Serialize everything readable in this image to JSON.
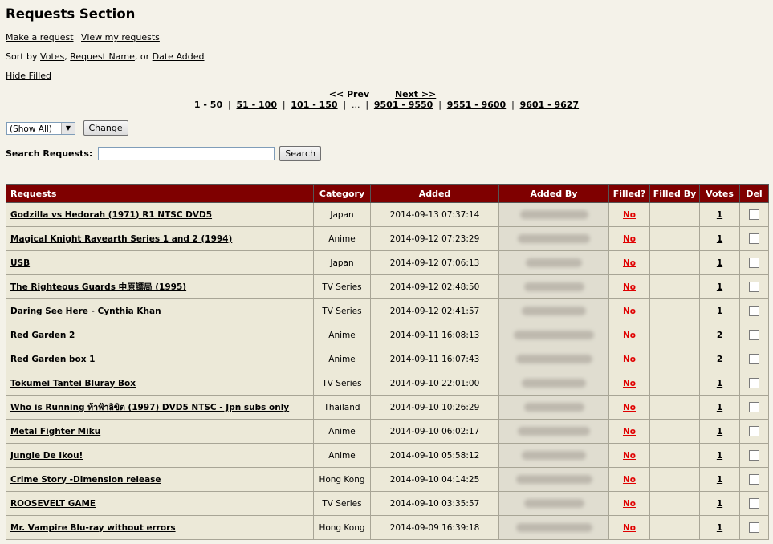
{
  "page_title": "Requests Section",
  "links": {
    "make_request": "Make a request",
    "view_my_requests": "View my requests",
    "hide_filled": "Hide Filled"
  },
  "sort": {
    "prefix": "Sort by",
    "votes": "Votes",
    "comma1": ",",
    "request_name": "Request Name",
    "or": ", or",
    "date_added": "Date Added"
  },
  "pager": {
    "prev": "<< Prev",
    "next": "Next >>",
    "current": "1 - 50",
    "pages": [
      "51 - 100",
      "101 - 150"
    ],
    "ellipsis": "...",
    "last_pages": [
      "9501 - 9550",
      "9551 - 9600",
      "9601 - 9627"
    ],
    "separator": "|"
  },
  "filter": {
    "selected": "(Show All)",
    "change_button": "Change"
  },
  "search": {
    "label": "Search Requests:",
    "value": "",
    "button": "Search"
  },
  "table": {
    "headers": [
      "Requests",
      "Category",
      "Added",
      "Added By",
      "Filled?",
      "Filled By",
      "Votes",
      "Del"
    ],
    "rows": [
      {
        "name": "Godzilla vs Hedorah (1971) R1 NTSC DVD5",
        "category": "Japan",
        "added": "2014-09-13 07:37:14",
        "filled": "No",
        "votes": "1"
      },
      {
        "name": "Magical Knight Rayearth Series 1 and 2 (1994)",
        "category": "Anime",
        "added": "2014-09-12 07:23:29",
        "filled": "No",
        "votes": "1"
      },
      {
        "name": "USB",
        "category": "Japan",
        "added": "2014-09-12 07:06:13",
        "filled": "No",
        "votes": "1"
      },
      {
        "name": "The Righteous Guards 中原镖局 (1995)",
        "category": "TV Series",
        "added": "2014-09-12 02:48:50",
        "filled": "No",
        "votes": "1"
      },
      {
        "name": "Daring See Here - Cynthia Khan",
        "category": "TV Series",
        "added": "2014-09-12 02:41:57",
        "filled": "No",
        "votes": "1"
      },
      {
        "name": "Red Garden 2",
        "category": "Anime",
        "added": "2014-09-11 16:08:13",
        "filled": "No",
        "votes": "2"
      },
      {
        "name": "Red Garden box 1",
        "category": "Anime",
        "added": "2014-09-11 16:07:43",
        "filled": "No",
        "votes": "2"
      },
      {
        "name": "Tokumei Tantei Bluray Box",
        "category": "TV Series",
        "added": "2014-09-10 22:01:00",
        "filled": "No",
        "votes": "1"
      },
      {
        "name": "Who is Running ท้าฟ้าลิขิต (1997) DVD5 NTSC - Jpn subs only",
        "category": "Thailand",
        "added": "2014-09-10 10:26:29",
        "filled": "No",
        "votes": "1"
      },
      {
        "name": "Metal Fighter Miku",
        "category": "Anime",
        "added": "2014-09-10 06:02:17",
        "filled": "No",
        "votes": "1"
      },
      {
        "name": "Jungle De Ikou!",
        "category": "Anime",
        "added": "2014-09-10 05:58:12",
        "filled": "No",
        "votes": "1"
      },
      {
        "name": "Crime Story -Dimension release",
        "category": "Hong Kong",
        "added": "2014-09-10 04:14:25",
        "filled": "No",
        "votes": "1"
      },
      {
        "name": "ROOSEVELT GAME",
        "category": "TV Series",
        "added": "2014-09-10 03:35:57",
        "filled": "No",
        "votes": "1"
      },
      {
        "name": "Mr. Vampire Blu-ray without errors",
        "category": "Hong Kong",
        "added": "2014-09-09 16:39:18",
        "filled": "No",
        "votes": "1"
      }
    ]
  },
  "colors": {
    "background": "#f4f2e9",
    "header": "#7f0000",
    "row": "#ece9d8",
    "filled_no": "#e00000"
  }
}
